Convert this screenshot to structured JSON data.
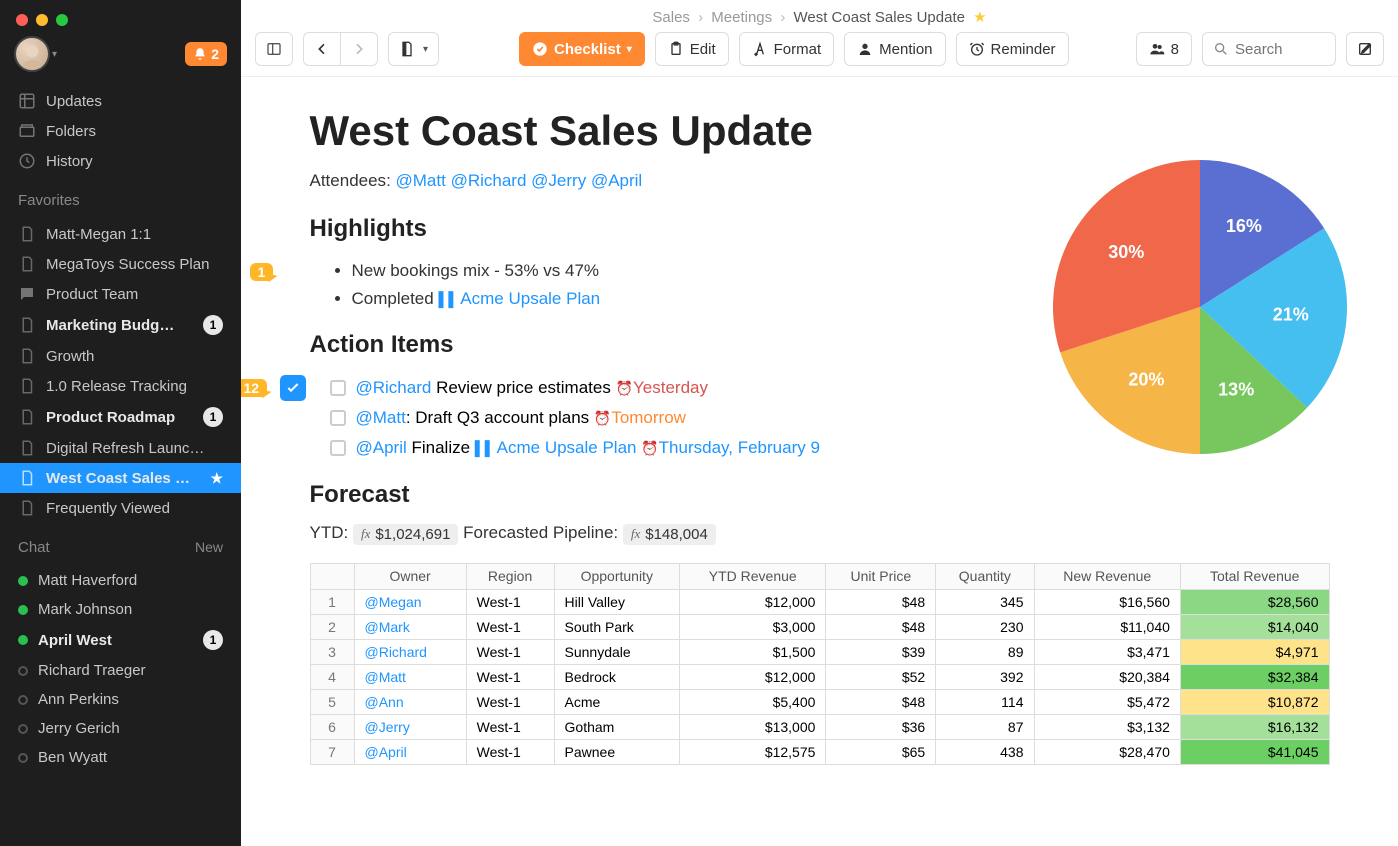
{
  "notif_count": "2",
  "breadcrumbs": {
    "a": "Sales",
    "b": "Meetings",
    "c": "West Coast Sales Update"
  },
  "toolbar": {
    "checklist": "Checklist",
    "edit": "Edit",
    "format": "Format",
    "mention": "Mention",
    "reminder": "Reminder",
    "people_count": "8",
    "search_placeholder": "Search"
  },
  "nav": {
    "updates": "Updates",
    "folders": "Folders",
    "history": "History",
    "favorites_title": "Favorites",
    "chat_title": "Chat",
    "chat_new": "New"
  },
  "favorites": [
    {
      "label": "Matt-Megan 1:1",
      "bold": false
    },
    {
      "label": "MegaToys Success Plan",
      "bold": false
    },
    {
      "label": "Product Team",
      "bold": false,
      "chat": true
    },
    {
      "label": "Marketing Budg…",
      "bold": true,
      "badge": "1"
    },
    {
      "label": "Growth",
      "bold": false
    },
    {
      "label": "1.0 Release Tracking",
      "bold": false
    },
    {
      "label": "Product Roadmap",
      "bold": true,
      "badge": "1"
    },
    {
      "label": "Digital Refresh Launc…",
      "bold": false
    },
    {
      "label": "West Coast Sales …",
      "bold": true,
      "active": true,
      "star": true
    },
    {
      "label": "Frequently Viewed",
      "bold": false
    }
  ],
  "chats": [
    {
      "name": "Matt Haverford",
      "online": true
    },
    {
      "name": "Mark Johnson",
      "online": true
    },
    {
      "name": "April West",
      "online": true,
      "bold": true,
      "badge": "1"
    },
    {
      "name": "Richard Traeger",
      "online": false
    },
    {
      "name": "Ann Perkins",
      "online": false
    },
    {
      "name": "Jerry Gerich",
      "online": false
    },
    {
      "name": "Ben Wyatt",
      "online": false
    }
  ],
  "doc": {
    "title": "West Coast Sales Update",
    "attendees_label": "Attendees",
    "attendees": [
      "@Matt",
      "@Richard",
      "@Jerry",
      "@April"
    ],
    "highlights_title": "Highlights",
    "highlight_comment_count": "1",
    "bullets_0": "New bookings mix - 53% vs 47%",
    "bullets_1_pre": "Completed ",
    "bullets_1_link": "Acme Upsale Plan",
    "action_title": "Action Items",
    "action_comment_count": "12",
    "actions": {
      "a0_m": "@Richard",
      "a0_t": " Review price estimates ",
      "a0_d": "Yesterday",
      "a1_m": "@Matt",
      "a1_t": ": Draft Q3 account plans ",
      "a1_d": "Tomorrow",
      "a2_m": "@April",
      "a2_t": " Finalize ",
      "a2_link": "Acme Upsale Plan",
      "a2_d": "Thursday, February 9"
    },
    "forecast_title": "Forecast",
    "ytd_label": "YTD: ",
    "ytd_val": "$1,024,691",
    "pipeline_label": "  Forecasted Pipeline: ",
    "pipeline_val": "$148,004"
  },
  "chart_data": {
    "type": "pie",
    "series": [
      {
        "label": "16%",
        "value": 16,
        "color": "#5a6fd1"
      },
      {
        "label": "21%",
        "value": 21,
        "color": "#45bef0"
      },
      {
        "label": "13%",
        "value": 13,
        "color": "#77c75e"
      },
      {
        "label": "20%",
        "value": 20,
        "color": "#f5b547"
      },
      {
        "label": "30%",
        "value": 30,
        "color": "#f0674a"
      }
    ]
  },
  "table": {
    "headers": [
      "Owner",
      "Region",
      "Opportunity",
      "YTD Revenue",
      "Unit Price",
      "Quantity",
      "New Revenue",
      "Total Revenue"
    ],
    "rows": [
      {
        "n": "1",
        "owner": "@Megan",
        "region": "West-1",
        "opp": "Hill Valley",
        "ytd": "$12,000",
        "price": "$48",
        "qty": "345",
        "newr": "$16,560",
        "tot": "$28,560",
        "cls": "tc-green"
      },
      {
        "n": "2",
        "owner": "@Mark",
        "region": "West-1",
        "opp": "South Park",
        "ytd": "$3,000",
        "price": "$48",
        "qty": "230",
        "newr": "$11,040",
        "tot": "$14,040",
        "cls": "tc-mgreen"
      },
      {
        "n": "3",
        "owner": "@Richard",
        "region": "West-1",
        "opp": "Sunnydale",
        "ytd": "$1,500",
        "price": "$39",
        "qty": "89",
        "newr": "$3,471",
        "tot": "$4,971",
        "cls": "tc-yellow"
      },
      {
        "n": "4",
        "owner": "@Matt",
        "region": "West-1",
        "opp": "Bedrock",
        "ytd": "$12,000",
        "price": "$52",
        "qty": "392",
        "newr": "$20,384",
        "tot": "$32,384",
        "cls": "tc-dgreen"
      },
      {
        "n": "5",
        "owner": "@Ann",
        "region": "West-1",
        "opp": "Acme",
        "ytd": "$5,400",
        "price": "$48",
        "qty": "114",
        "newr": "$5,472",
        "tot": "$10,872",
        "cls": "tc-yellow"
      },
      {
        "n": "6",
        "owner": "@Jerry",
        "region": "West-1",
        "opp": "Gotham",
        "ytd": "$13,000",
        "price": "$36",
        "qty": "87",
        "newr": "$3,132",
        "tot": "$16,132",
        "cls": "tc-mgreen"
      },
      {
        "n": "7",
        "owner": "@April",
        "region": "West-1",
        "opp": "Pawnee",
        "ytd": "$12,575",
        "price": "$65",
        "qty": "438",
        "newr": "$28,470",
        "tot": "$41,045",
        "cls": "tc-dgreen"
      }
    ]
  }
}
